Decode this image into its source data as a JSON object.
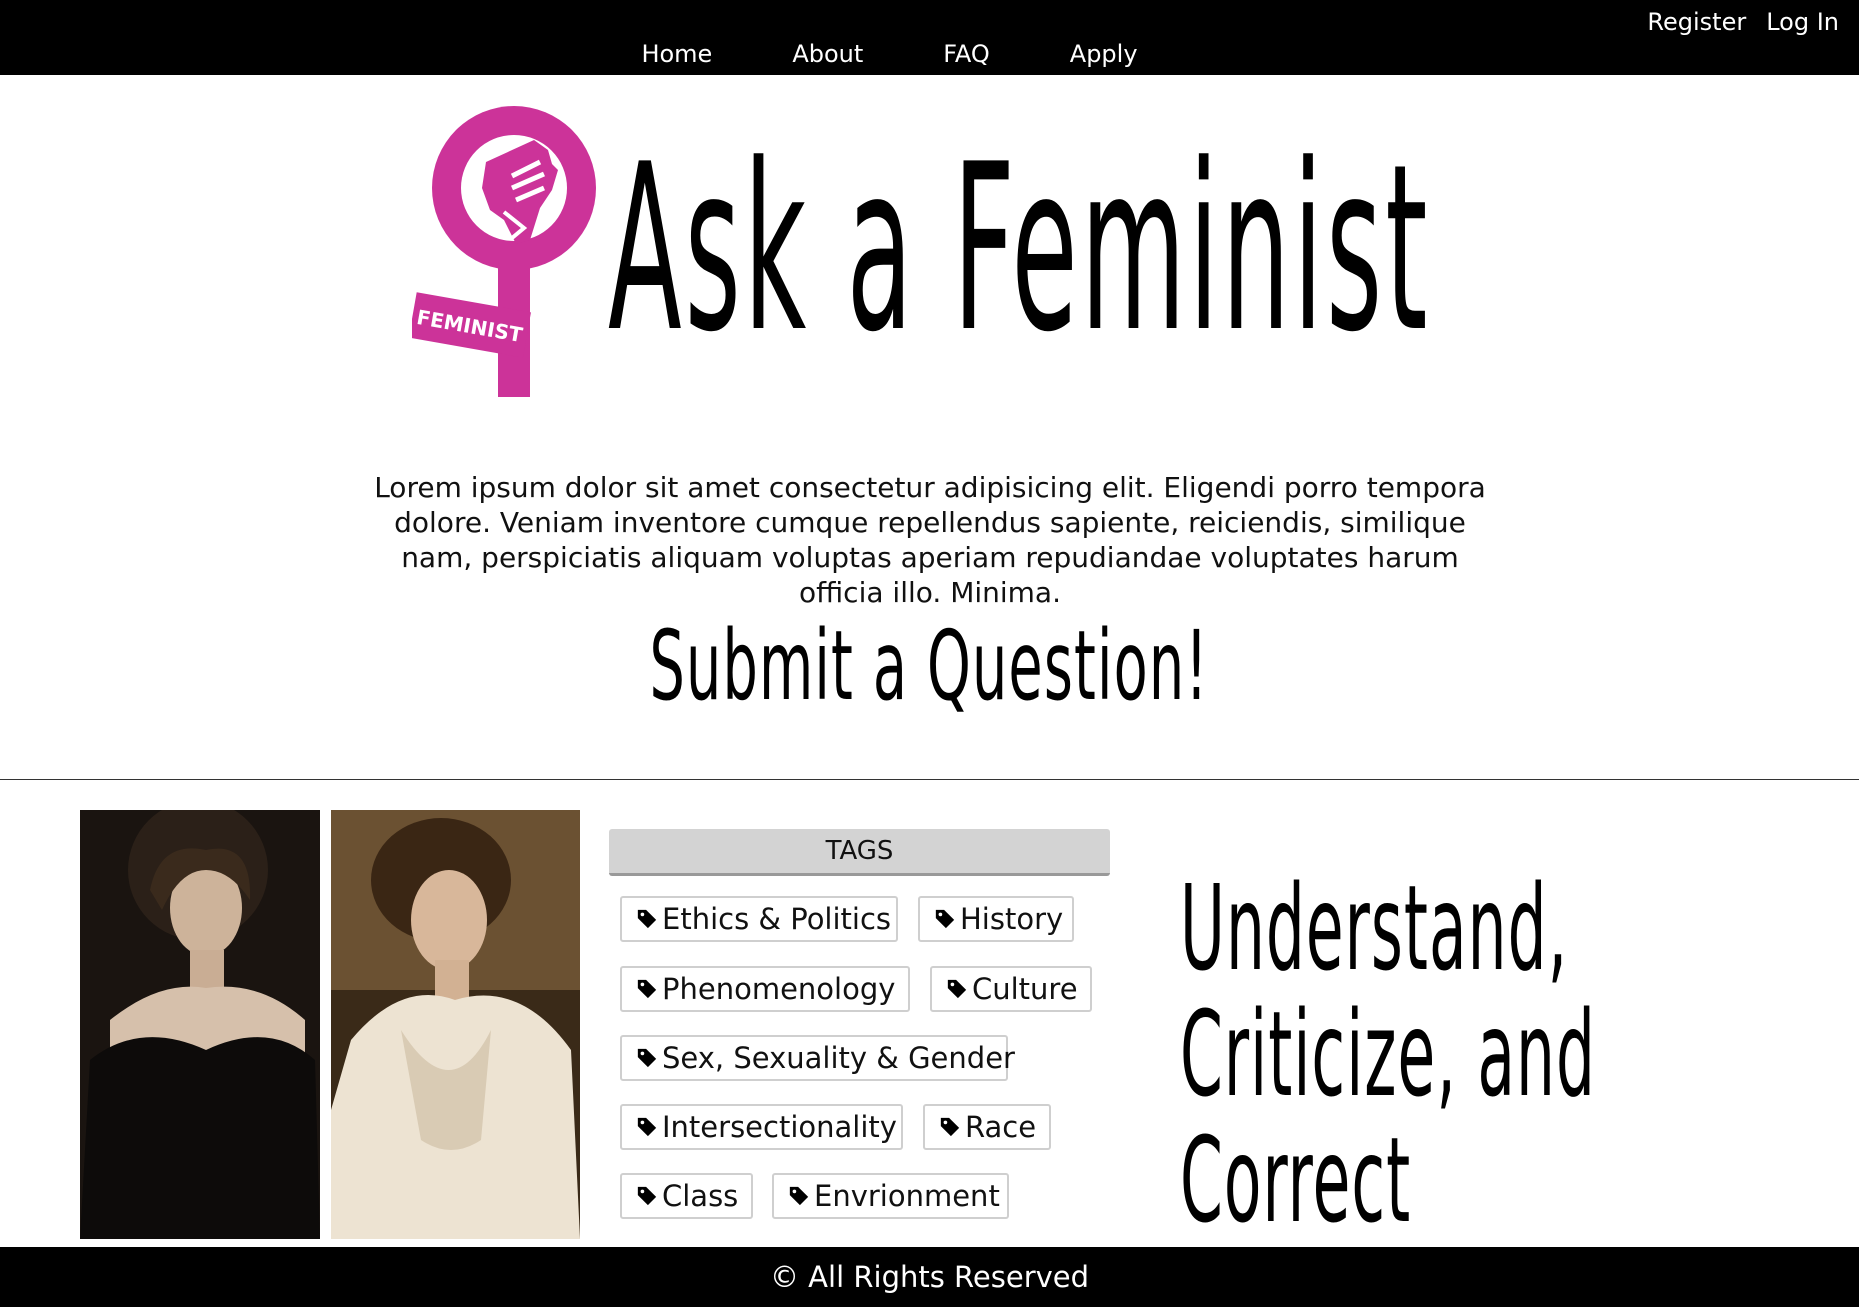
{
  "header": {
    "auth": {
      "register": "Register",
      "login": "Log In"
    },
    "nav": [
      "Home",
      "About",
      "FAQ",
      "Apply"
    ]
  },
  "hero": {
    "logo_badge_text": "FEMINIST",
    "logo_color": "#cc3399",
    "title": "Ask a Feminist",
    "intro": "Lorem ipsum dolor sit amet consectetur adipisicing elit. Eligendi porro tempora dolore. Veniam inventore cumque repellendus sapiente, reiciendis, similique nam, perspiciatis aliquam voluptas aperiam repudiandae voluptates harum officia illo. Minima.",
    "cta": "Submit a Question!"
  },
  "tags": {
    "header": "TAGS",
    "items": [
      "Ethics & Politics",
      "History",
      "Phenomenology",
      "Culture",
      "Sex, Sexuality & Gender",
      "Intersectionality",
      "Race",
      "Class",
      "Envrionment"
    ],
    "icon": "tag-icon"
  },
  "slogan": {
    "lines": [
      "Understand,",
      "Criticize, and",
      "Correct"
    ]
  },
  "footer": {
    "text": "© All Rights Reserved"
  }
}
